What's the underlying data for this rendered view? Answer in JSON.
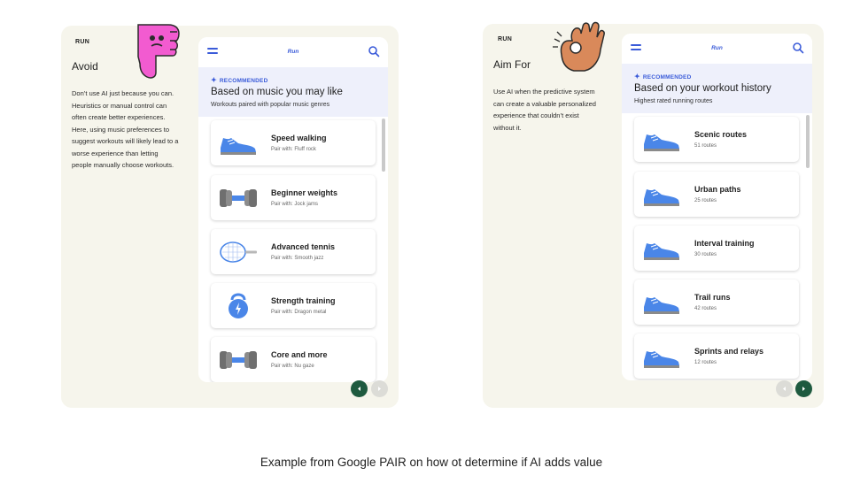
{
  "avoid": {
    "tag": "RUN",
    "heading": "Avoid",
    "description": [
      "Don’t use AI just because you can.",
      "Heuristics or manual control can",
      "often create better experiences.",
      "Here, using music preferences to",
      "suggest workouts will likely lead to a",
      "worse experience than letting",
      "people manually choose workouts."
    ],
    "phone": {
      "app_title": "Run",
      "rec_label": "RECOMMENDED",
      "rec_title": "Based on music you may like",
      "rec_sub": "Workouts paired with popular music genres",
      "items": [
        {
          "name": "Speed walking",
          "sub": "Pair with: Fluff rock",
          "icon": "shoe"
        },
        {
          "name": "Beginner weights",
          "sub": "Pair with: Jock jams",
          "icon": "dumbbell"
        },
        {
          "name": "Advanced tennis",
          "sub": "Pair with: Smooth jazz",
          "icon": "racket"
        },
        {
          "name": "Strength training",
          "sub": "Pair with: Dragon metal",
          "icon": "kettlebell"
        },
        {
          "name": "Core and more",
          "sub": "Pair with: Nu gaze",
          "icon": "dumbbell"
        }
      ]
    }
  },
  "aim": {
    "tag": "RUN",
    "heading": "Aim For",
    "description": [
      "Use AI when the predictive system",
      "can create a valuable personalized",
      "experience that couldn’t exist",
      "without it."
    ],
    "phone": {
      "app_title": "Run",
      "rec_label": "RECOMMENDED",
      "rec_title": "Based on your workout history",
      "rec_sub": "Highest rated running routes",
      "items": [
        {
          "name": "Scenic routes",
          "sub": "51 routes",
          "icon": "shoe"
        },
        {
          "name": "Urban paths",
          "sub": "25 routes",
          "icon": "shoe"
        },
        {
          "name": "Interval training",
          "sub": "30 routes",
          "icon": "shoe"
        },
        {
          "name": "Trail runs",
          "sub": "42 routes",
          "icon": "shoe"
        },
        {
          "name": "Sprints and relays",
          "sub": "12 routes",
          "icon": "shoe"
        }
      ]
    }
  },
  "colors": {
    "accent": "#3a5bd9",
    "card_bg": "#f6f5ec",
    "rec_bg": "#eef0fb",
    "pager_active": "#1e5a3f",
    "sticker_pink": "#f25bd0",
    "sticker_skin": "#d9895a"
  },
  "caption": "Example from Google PAIR on how ot determine if AI adds value"
}
